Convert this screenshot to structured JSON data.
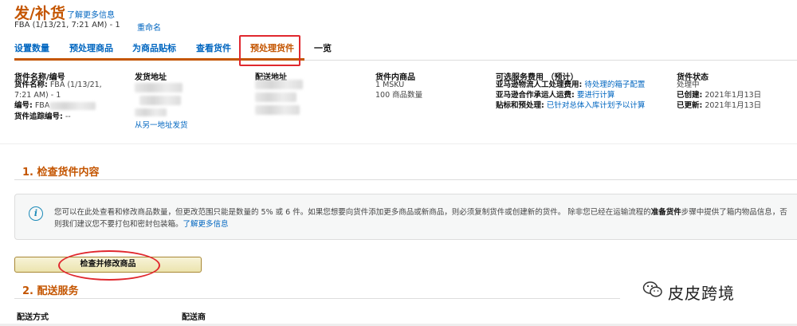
{
  "header": {
    "title": "发/补货",
    "learn_more": "了解更多信息",
    "subtitle": "FBA (1/13/21, 7:21 AM) - 1",
    "rename": "重命名"
  },
  "tabs": [
    {
      "label": "设置数量"
    },
    {
      "label": "预处理商品"
    },
    {
      "label": "为商品贴标"
    },
    {
      "label": "查看货件"
    },
    {
      "label": "预处理货件",
      "active": true
    },
    {
      "label": "一览"
    }
  ],
  "summary": {
    "col1": {
      "header": "货件名称/编号",
      "name_label": "货件名称:",
      "name_value": "FBA (1/13/21, 7:21 AM) - 1",
      "id_label": "编号:",
      "id_value": "FBA",
      "tracking_label": "货件追踪编号:",
      "tracking_value": "--"
    },
    "col2": {
      "header": "发货地址",
      "link": "从另一地址发货"
    },
    "col3": {
      "header": "配送地址"
    },
    "col4": {
      "header": "货件内商品",
      "msku": "1 MSKU",
      "units": "100 商品数量"
    },
    "col5": {
      "header": "可选服务费用 （预计）",
      "row1_label": "亚马逊物流人工处理费用:",
      "row1_value": "待处理的箱子配置",
      "row2_label": "亚马逊合作承运人运费:",
      "row2_value": "要进行计算",
      "row3_label": "贴标和预处理:",
      "row3_value": "已针对总体入库计划予以计算"
    },
    "col6": {
      "header": "货件状态",
      "status": "处理中",
      "created_label": "已创建:",
      "created_value": "2021年1月13日",
      "updated_label": "已更新:",
      "updated_value": "2021年1月13日"
    }
  },
  "section1": {
    "heading": "1. 检查货件内容",
    "info_text_a": "您可以在此处查看和修改商品数量，但更改范围只能是数量的 5% 或 6 件。如果您想要向货件添加更多商品或新商品，则必须复制货件或创建新的货件。 除非您已经在运输流程的",
    "info_bold": "准备货件",
    "info_text_b": "步骤中提供了箱内物品信息，否则我们建议您不要打包和密封包装箱。",
    "info_link": "了解更多信息",
    "button": "检查并修改商品"
  },
  "section2": {
    "heading": "2. 配送服务",
    "method_label": "配送方式",
    "carrier_label": "配送商"
  },
  "watermark": {
    "text": "皮皮跨境"
  },
  "colors": {
    "accent": "#c45500",
    "link": "#0066c0",
    "highlight": "#e0282e"
  }
}
